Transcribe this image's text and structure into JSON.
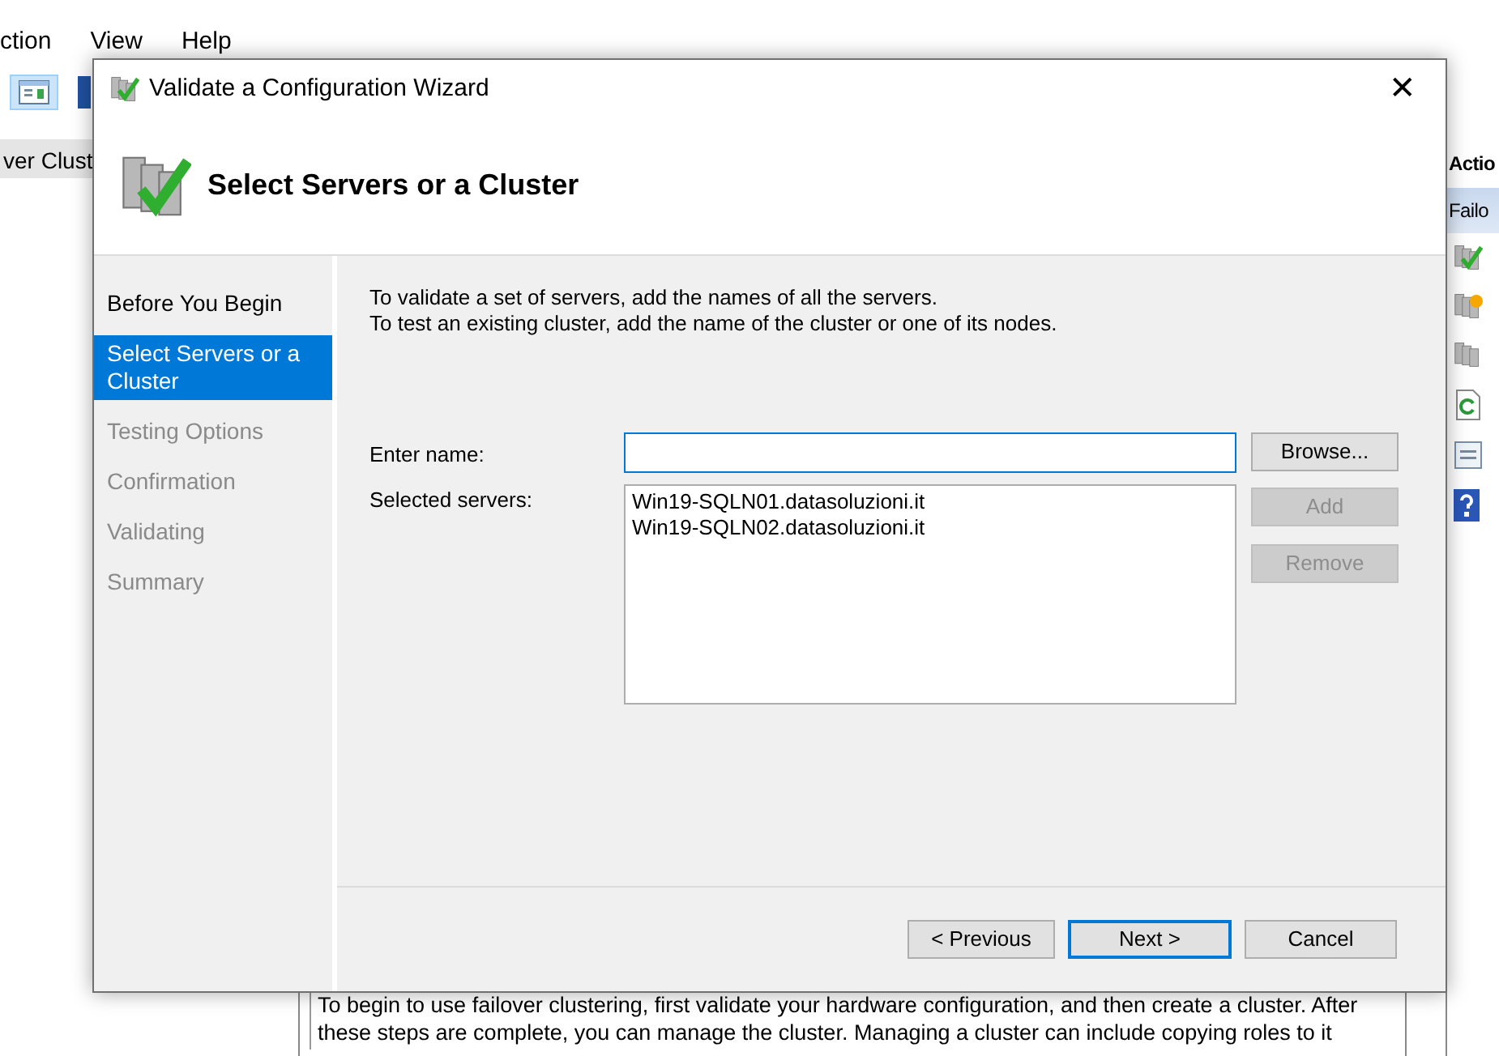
{
  "background_app": {
    "menu": [
      "ction",
      "View",
      "Help"
    ],
    "tree_item": "ver Clust",
    "actions_header": "Actio",
    "actions_group": "Failo",
    "description": [
      "To begin to use failover clustering, first validate your hardware configuration, and then create a cluster.  After",
      "these steps are complete, you can manage the cluster. Managing a cluster can include copying roles to it"
    ]
  },
  "wizard": {
    "title": "Validate a Configuration Wizard",
    "close_glyph": "✕",
    "heading": "Select Servers or a Cluster",
    "steps": [
      {
        "label": "Before You Begin",
        "selected": false,
        "disabled": false
      },
      {
        "label": "Select Servers or a Cluster",
        "selected": true,
        "disabled": false
      },
      {
        "label": "Testing Options",
        "selected": false,
        "disabled": true
      },
      {
        "label": "Confirmation",
        "selected": false,
        "disabled": true
      },
      {
        "label": "Validating",
        "selected": false,
        "disabled": true
      },
      {
        "label": "Summary",
        "selected": false,
        "disabled": true
      }
    ],
    "intro": [
      "To validate a set of servers, add the names of all the servers.",
      "To test an existing cluster, add the name of the cluster or one of its nodes."
    ],
    "enter_name_label": "Enter name:",
    "selected_servers_label": "Selected servers:",
    "selected_servers": [
      "Win19-SQLN01.datasoluzioni.it",
      "Win19-SQLN02.datasoluzioni.it"
    ],
    "side_buttons": [
      {
        "label": "Browse...",
        "disabled": false
      },
      {
        "label": "Add",
        "disabled": true
      },
      {
        "label": "Remove",
        "disabled": true
      }
    ],
    "nav_buttons": [
      {
        "label": "< Previous",
        "default": false
      },
      {
        "label": "Next >",
        "default": true
      },
      {
        "label": "Cancel",
        "default": false
      }
    ]
  }
}
